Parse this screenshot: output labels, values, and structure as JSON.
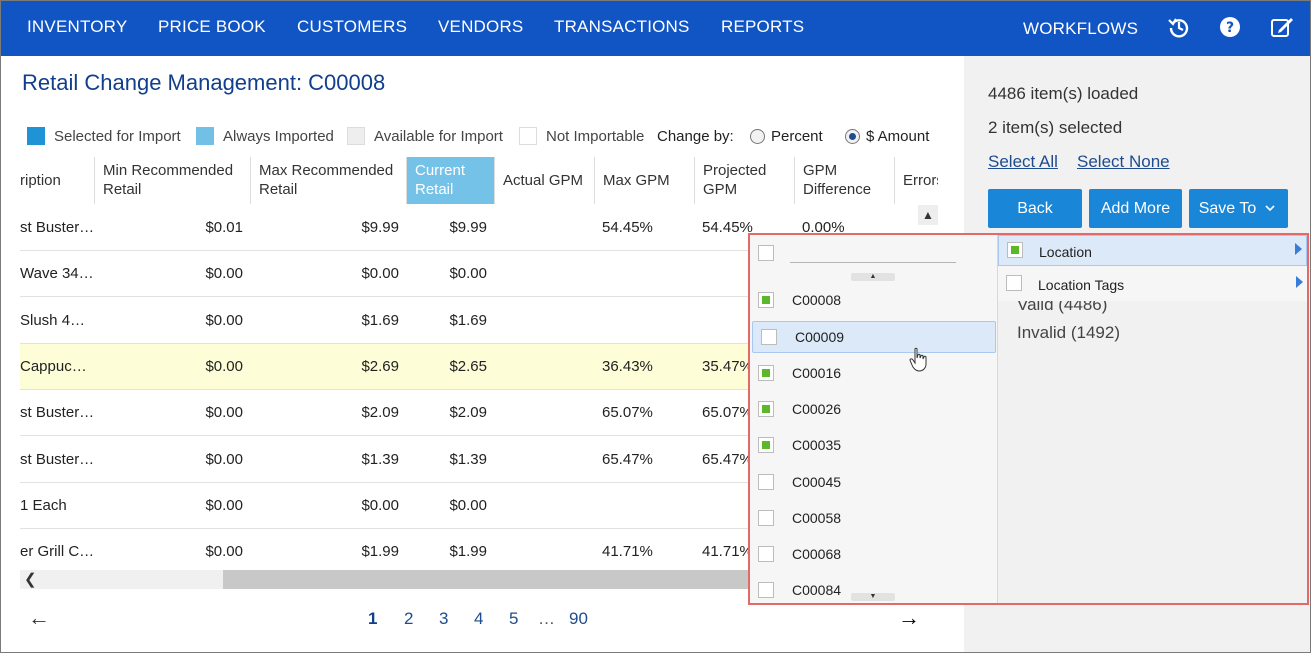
{
  "nav": {
    "items": [
      "INVENTORY",
      "PRICE BOOK",
      "CUSTOMERS",
      "VENDORS",
      "TRANSACTIONS",
      "REPORTS"
    ],
    "workflows": "WORKFLOWS",
    "icons": [
      "history-icon",
      "help-icon",
      "edit-icon"
    ]
  },
  "page": {
    "title": "Retail Change Management: C00008"
  },
  "legend": {
    "selected": "Selected for Import",
    "always": "Always Imported",
    "available": "Available for Import",
    "not_importable": "Not Importable",
    "colors": {
      "selected": "#1f93d6",
      "always": "#72c0e6",
      "available": "#eeeeee",
      "not_importable": "#ffffff"
    }
  },
  "change_by": {
    "label": "Change by:",
    "percent": "Percent",
    "amount": "$ Amount",
    "selected": "amount"
  },
  "grid": {
    "headers": {
      "description": "ription",
      "min_retail": "Min Recommended Retail",
      "max_retail": "Max Recommended Retail",
      "current_retail": "Current Retail",
      "actual_gpm": "Actual GPM",
      "max_gpm": "Max GPM",
      "projected_gpm": "Projected GPM",
      "gpm_diff": "GPM Difference",
      "errors": "Errors"
    },
    "rows": [
      {
        "desc": "st Buster…",
        "min": "$0.01",
        "max": "$9.99",
        "cur": "$9.99",
        "maxgpm": "54.45%",
        "proj": "54.45%",
        "diff": "0.00%"
      },
      {
        "desc": "Wave 34…",
        "min": "$0.00",
        "max": "$0.00",
        "cur": "$0.00",
        "maxgpm": "",
        "proj": "",
        "diff": ""
      },
      {
        "desc": " Slush 4…",
        "min": "$0.00",
        "max": "$1.69",
        "cur": "$1.69",
        "maxgpm": "",
        "proj": "",
        "diff": ""
      },
      {
        "desc": " Cappuc…",
        "min": "$0.00",
        "max": "$2.69",
        "cur": "$2.65",
        "maxgpm": "36.43%",
        "proj": "35.47%",
        "diff": ""
      },
      {
        "desc": "st Buster…",
        "min": "$0.00",
        "max": "$2.09",
        "cur": "$2.09",
        "maxgpm": "65.07%",
        "proj": "65.07%",
        "diff": ""
      },
      {
        "desc": "st Buster…",
        "min": "$0.00",
        "max": "$1.39",
        "cur": "$1.39",
        "maxgpm": "65.47%",
        "proj": "65.47%",
        "diff": ""
      },
      {
        "desc": " 1 Each",
        "min": "$0.00",
        "max": "$0.00",
        "cur": "$0.00",
        "maxgpm": "",
        "proj": "",
        "diff": ""
      },
      {
        "desc": "er Grill C…",
        "min": "$0.00",
        "max": "$1.99",
        "cur": "$1.99",
        "maxgpm": "41.71%",
        "proj": "41.71%",
        "diff": ""
      }
    ]
  },
  "pagination": {
    "pages": [
      "1",
      "2",
      "3",
      "4",
      "5",
      "…",
      "90"
    ],
    "prev": "←",
    "next": "→",
    "current": "1"
  },
  "panel": {
    "loaded": "4486 item(s) loaded",
    "selected": "2 item(s) selected",
    "select_all": "Select All",
    "select_none": "Select None",
    "back": "Back",
    "add_more": "Add More",
    "save_to": "Save To",
    "valid": "Valid (4486)",
    "invalid": "Invalid (1492)"
  },
  "dropdown": {
    "locations": [
      {
        "code": "C00008",
        "checked": true
      },
      {
        "code": "C00009",
        "checked": false
      },
      {
        "code": "C00016",
        "checked": true
      },
      {
        "code": "C00026",
        "checked": true
      },
      {
        "code": "C00035",
        "checked": true
      },
      {
        "code": "C00045",
        "checked": false
      },
      {
        "code": "C00058",
        "checked": false
      },
      {
        "code": "C00068",
        "checked": false
      },
      {
        "code": "C00084",
        "checked": false
      }
    ],
    "submenu": [
      {
        "label": "Location",
        "checked": true
      },
      {
        "label": "Location Tags",
        "checked": false
      }
    ]
  }
}
